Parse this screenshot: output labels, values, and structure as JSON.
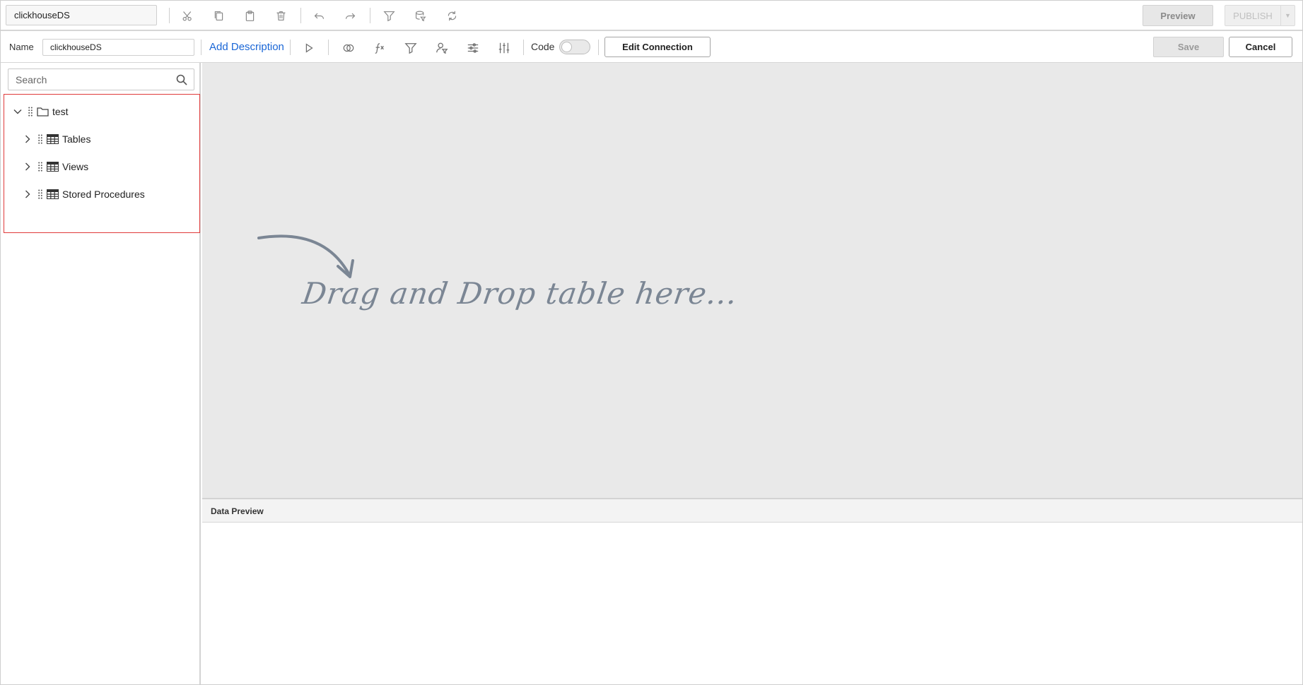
{
  "toolbar": {
    "datasource_title": "clickhouseDS",
    "preview_label": "Preview",
    "publish_label": "PUBLISH",
    "icons": [
      "cut-icon",
      "copy-icon",
      "paste-icon",
      "delete-icon",
      "undo-icon",
      "redo-icon",
      "filter-icon",
      "database-filter-icon",
      "refresh-icon"
    ]
  },
  "subtoolbar": {
    "name_label": "Name",
    "name_value": "clickhouseDS",
    "add_description_label": "Add Description",
    "code_label": "Code",
    "code_enabled": false,
    "edit_connection_label": "Edit Connection",
    "save_label": "Save",
    "cancel_label": "Cancel",
    "icons": [
      "run-icon",
      "join-icon",
      "expression-icon",
      "filter-icon",
      "user-filter-icon",
      "settings-sliders-icon",
      "parameters-icon"
    ]
  },
  "sidebar": {
    "search_placeholder": "Search",
    "tree": {
      "root": {
        "label": "test",
        "expanded": true
      },
      "items": [
        {
          "label": "Tables",
          "expanded": false
        },
        {
          "label": "Views",
          "expanded": false
        },
        {
          "label": "Stored Procedures",
          "expanded": false
        }
      ]
    }
  },
  "canvas": {
    "drop_hint": "Drag and Drop table here..."
  },
  "data_preview": {
    "title": "Data Preview"
  },
  "colors": {
    "link": "#1a66d6",
    "highlight_border": "#e03a3a",
    "canvas_bg": "#e9e9e9",
    "hint_text": "#7b8694"
  }
}
